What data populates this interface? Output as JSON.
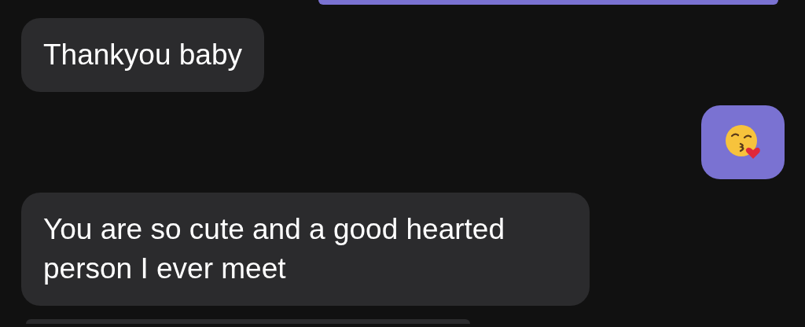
{
  "messages": [
    {
      "sent": true,
      "kind": "partial"
    },
    {
      "sent": false,
      "kind": "text",
      "text": "Thankyou baby"
    },
    {
      "sent": true,
      "kind": "emoji"
    },
    {
      "sent": false,
      "kind": "text",
      "text": "You are so cute and a good hearted person I ever meet"
    },
    {
      "sent": false,
      "kind": "partial"
    }
  ]
}
